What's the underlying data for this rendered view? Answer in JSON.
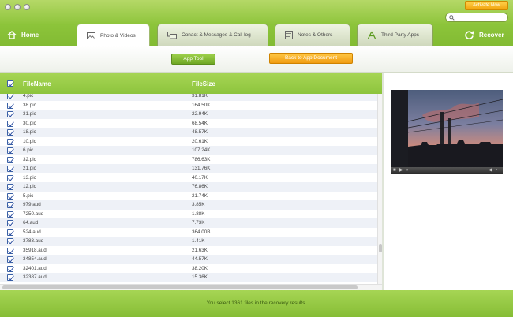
{
  "header": {
    "activate_label": "Activate Now",
    "home_label": "Home",
    "recover_label": "Recover",
    "search": {
      "placeholder": ""
    }
  },
  "tabs": [
    {
      "label": "Photo & Videos",
      "icon": "photo-icon",
      "active": true
    },
    {
      "label": "Conact & Messages & Call log",
      "icon": "messages-icon",
      "active": false
    },
    {
      "label": "Notes & Others",
      "icon": "notes-icon",
      "active": false
    },
    {
      "label": "Third Party Apps",
      "icon": "apps-icon",
      "active": false
    }
  ],
  "toolbar": {
    "app_tool_label": "App Tool",
    "back_label": "Back to App Document"
  },
  "table": {
    "columns": {
      "name": "FileName",
      "size": "FileSize"
    },
    "rows": [
      {
        "name": "4.pic",
        "size": "31.81K"
      },
      {
        "name": "38.pic",
        "size": "164.50K"
      },
      {
        "name": "31.pic",
        "size": "22.94K"
      },
      {
        "name": "30.pic",
        "size": "68.54K"
      },
      {
        "name": "18.pic",
        "size": "48.57K"
      },
      {
        "name": "10.pic",
        "size": "20.61K"
      },
      {
        "name": "6.pic",
        "size": "107.24K"
      },
      {
        "name": "32.pic",
        "size": "786.63K"
      },
      {
        "name": "21.pic",
        "size": "131.76K"
      },
      {
        "name": "13.pic",
        "size": "40.17K"
      },
      {
        "name": "12.pic",
        "size": "76.86K"
      },
      {
        "name": "5.pic",
        "size": "21.74K"
      },
      {
        "name": "979.aud",
        "size": "3.85K"
      },
      {
        "name": "7250.aud",
        "size": "1.88K"
      },
      {
        "name": "64.aud",
        "size": "7.73K"
      },
      {
        "name": "524.aud",
        "size": "364.00B"
      },
      {
        "name": "3783.aud",
        "size": "1.41K"
      },
      {
        "name": "35918.aud",
        "size": "21.63K"
      },
      {
        "name": "34854.aud",
        "size": "44.57K"
      },
      {
        "name": "32401.aud",
        "size": "38.20K"
      },
      {
        "name": "32387.aud",
        "size": "15.36K"
      }
    ]
  },
  "footer": {
    "status": "You select 1361 files in the recovery results."
  },
  "colors": {
    "brand_green": "#8cc43a",
    "accent_orange": "#f2a40d",
    "checkbox_blue": "#2a4da0"
  }
}
